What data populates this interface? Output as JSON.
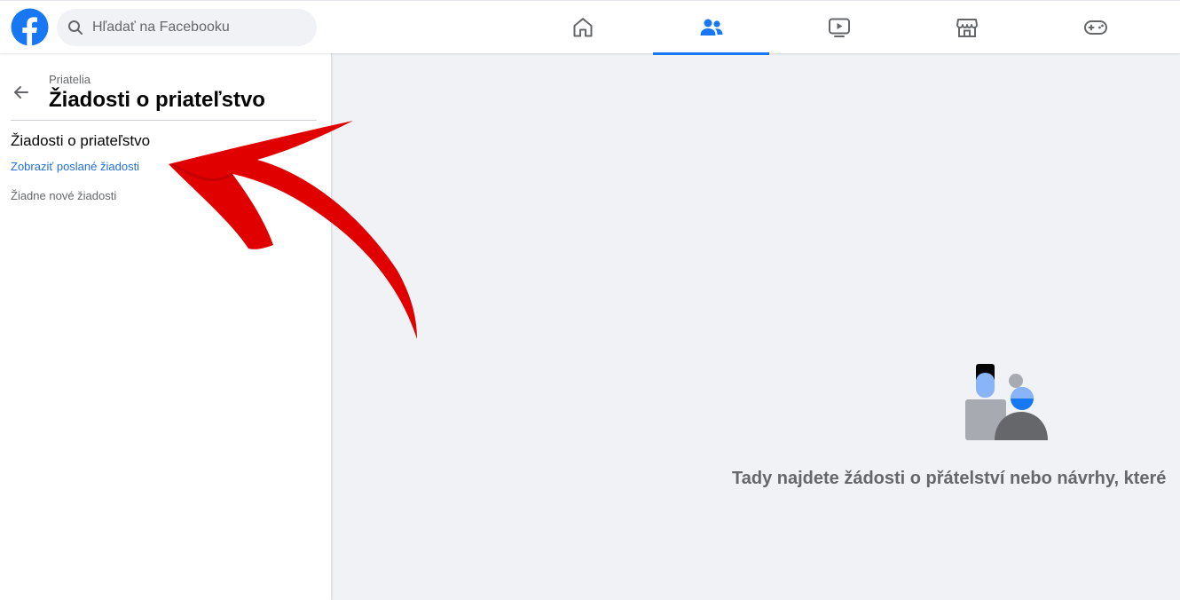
{
  "search": {
    "placeholder": "Hľadať na Facebooku"
  },
  "nav": {
    "tabs": [
      {
        "name": "home",
        "icon": "home-icon",
        "active": false
      },
      {
        "name": "friends",
        "icon": "friends-icon",
        "active": true
      },
      {
        "name": "watch",
        "icon": "video-icon",
        "active": false
      },
      {
        "name": "marketplace",
        "icon": "store-icon",
        "active": false
      },
      {
        "name": "gaming",
        "icon": "gamepad-icon",
        "active": false
      }
    ]
  },
  "sidebar": {
    "breadcrumb": "Priatelia",
    "title": "Žiadosti o priateľstvo",
    "section_title": "Žiadosti o priateľstvo",
    "sent_link": "Zobraziť poslané žiadosti",
    "empty_text": "Žiadne nové žiadosti"
  },
  "main": {
    "message": "Tady najdete žádosti o přátelství nebo návrhy, které"
  },
  "colors": {
    "brand": "#1877f2",
    "icon_gray": "#65676b",
    "annotation": "#e00000"
  }
}
